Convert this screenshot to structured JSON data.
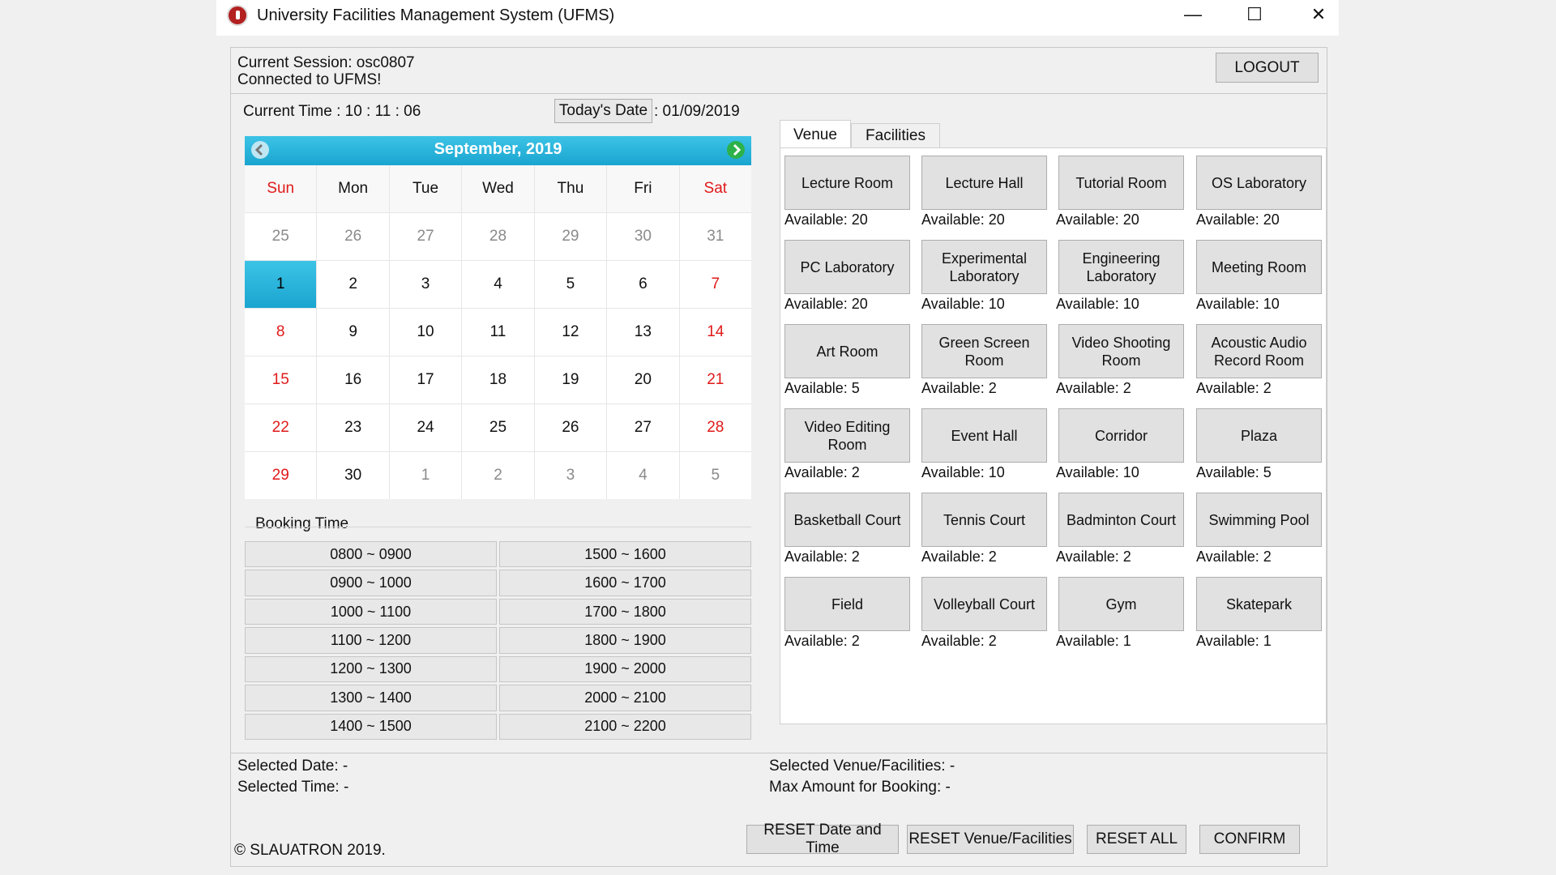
{
  "window": {
    "title": "University Facilities Management System (UFMS)",
    "minimize": "—",
    "maximize": "☐",
    "close": "✕"
  },
  "session": {
    "current_session": "Current Session: osc0807",
    "connected": "Connected to UFMS!",
    "logout": "LOGOUT"
  },
  "clock": {
    "time_label": "Current Time   :  10 : 11 : 06",
    "today_button": "Today's Date",
    "today_value": ":  01/09/2019"
  },
  "calendar": {
    "title": "September,  2019",
    "weekdays": [
      "Sun",
      "Mon",
      "Tue",
      "Wed",
      "Thu",
      "Fri",
      "Sat"
    ],
    "days": [
      "25",
      "26",
      "27",
      "28",
      "29",
      "30",
      "31",
      "1",
      "2",
      "3",
      "4",
      "5",
      "6",
      "7",
      "8",
      "9",
      "10",
      "11",
      "12",
      "13",
      "14",
      "15",
      "16",
      "17",
      "18",
      "19",
      "20",
      "21",
      "22",
      "23",
      "24",
      "25",
      "26",
      "27",
      "28",
      "29",
      "30",
      "1",
      "2",
      "3",
      "4",
      "5"
    ]
  },
  "booking": {
    "label": "Booking Time",
    "slots": [
      "0800 ~ 0900",
      "1500 ~ 1600",
      "0900 ~ 1000",
      "1600 ~ 1700",
      "1000 ~ 1100",
      "1700 ~ 1800",
      "1100 ~ 1200",
      "1800 ~ 1900",
      "1200 ~ 1300",
      "1900 ~ 2000",
      "1300 ~ 1400",
      "2000 ~ 2100",
      "1400 ~ 1500",
      "2100 ~ 2200"
    ]
  },
  "tabs": [
    "Venue",
    "Facilities"
  ],
  "venues": [
    {
      "name": "Lecture Room",
      "available": "Available: 20"
    },
    {
      "name": "Lecture Hall",
      "available": "Available: 20"
    },
    {
      "name": "Tutorial Room",
      "available": "Available:  20"
    },
    {
      "name": "OS Laboratory",
      "available": "Available: 20"
    },
    {
      "name": "PC Laboratory",
      "available": "Available: 20"
    },
    {
      "name": "Experimental Laboratory",
      "available": "Available: 10"
    },
    {
      "name": "Engineering Laboratory",
      "available": "Available: 10"
    },
    {
      "name": "Meeting Room",
      "available": "Available: 10"
    },
    {
      "name": "Art Room",
      "available": "Available: 5"
    },
    {
      "name": "Green Screen Room",
      "available": "Available: 2"
    },
    {
      "name": "Video Shooting Room",
      "available": "Available: 2"
    },
    {
      "name": "Acoustic Audio Record Room",
      "available": "Available: 2"
    },
    {
      "name": "Video Editing Room",
      "available": "Available: 2"
    },
    {
      "name": "Event Hall",
      "available": "Available: 10"
    },
    {
      "name": "Corridor",
      "available": "Available: 10"
    },
    {
      "name": "Plaza",
      "available": "Available: 5"
    },
    {
      "name": "Basketball Court",
      "available": "Available: 2"
    },
    {
      "name": "Tennis Court",
      "available": "Available: 2"
    },
    {
      "name": "Badminton Court",
      "available": "Available: 2"
    },
    {
      "name": "Swimming Pool",
      "available": "Available: 2"
    },
    {
      "name": "Field",
      "available": "Available: 2"
    },
    {
      "name": "Volleyball Court",
      "available": "Available: 2"
    },
    {
      "name": "Gym",
      "available": "Available: 1"
    },
    {
      "name": "Skatepark",
      "available": "Available: 1"
    }
  ],
  "status": {
    "selected_date": "Selected Date: -",
    "selected_time": "Selected Time: -",
    "selected_venue": "Selected Venue/Facilities: -",
    "max_amount": "Max Amount for Booking: -"
  },
  "actions": {
    "reset_date_time": "RESET Date and Time",
    "reset_venue": "RESET Venue/Facilities",
    "reset_all": "RESET ALL",
    "confirm": "CONFIRM"
  },
  "footer": {
    "copyright": "© SLAUATRON 2019."
  }
}
